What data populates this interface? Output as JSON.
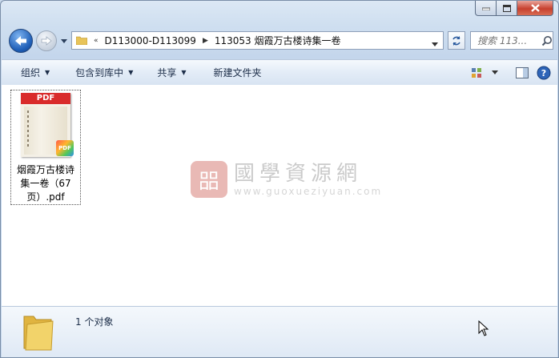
{
  "window": {
    "caption_buttons": {
      "minimize": "minimize",
      "maximize": "maximize",
      "close": "close"
    }
  },
  "nav": {
    "breadcrumbs": [
      "D113000-D113099",
      "113053 烟霞万古楼诗集一卷"
    ],
    "overflow_chevron": "«",
    "search_placeholder": "搜索 113..."
  },
  "toolbar": {
    "organize": "组织",
    "include_in_library": "包含到库中",
    "share": "共享",
    "new_folder": "新建文件夹"
  },
  "files": [
    {
      "type_band": "PDF",
      "badge": "PDF",
      "name_lines": [
        "烟霞万古楼诗",
        "集一卷（67",
        "页）.pdf"
      ]
    }
  ],
  "watermark": {
    "seal": "㗊",
    "title": "國學資源網",
    "url": "www.guoxueziyuan.com"
  },
  "status": {
    "count": "1 个对象"
  },
  "colors": {
    "accent_blue": "#1f5fb8",
    "close_red": "#c7402e",
    "pdf_red": "#d92b2b"
  }
}
